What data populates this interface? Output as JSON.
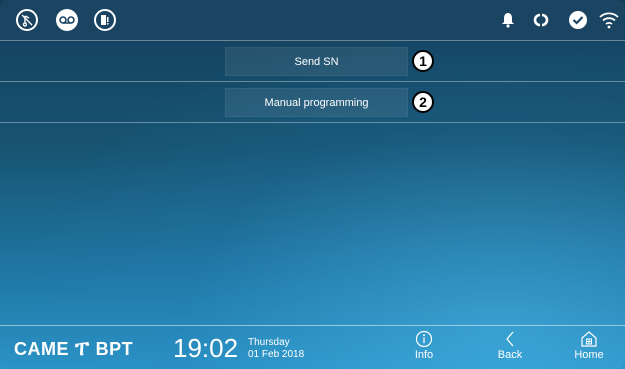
{
  "topbar": {
    "left_icons": [
      {
        "name": "mute-ringtone-icon"
      },
      {
        "name": "answering-machine-icon"
      },
      {
        "name": "door-open-icon"
      }
    ],
    "right_icons": [
      {
        "name": "bell-icon"
      },
      {
        "name": "link-icon"
      },
      {
        "name": "check-icon"
      },
      {
        "name": "wifi-icon"
      }
    ]
  },
  "menu": {
    "items": [
      {
        "label": "Send SN",
        "badge": "1"
      },
      {
        "label": "Manual programming",
        "badge": "2"
      }
    ]
  },
  "bottombar": {
    "logo_left": "CAME",
    "logo_mark": "ፐ",
    "logo_right": "BPT",
    "time": "19:02",
    "weekday": "Thursday",
    "date": "01 Feb 2018",
    "info_label": "Info",
    "back_label": "Back",
    "home_label": "Home"
  },
  "colors": {
    "topbar_bg": "#1a4461",
    "background_top": "#133e5a",
    "background_bottom": "#2b93c6",
    "badge_bg": "#ffffff"
  }
}
